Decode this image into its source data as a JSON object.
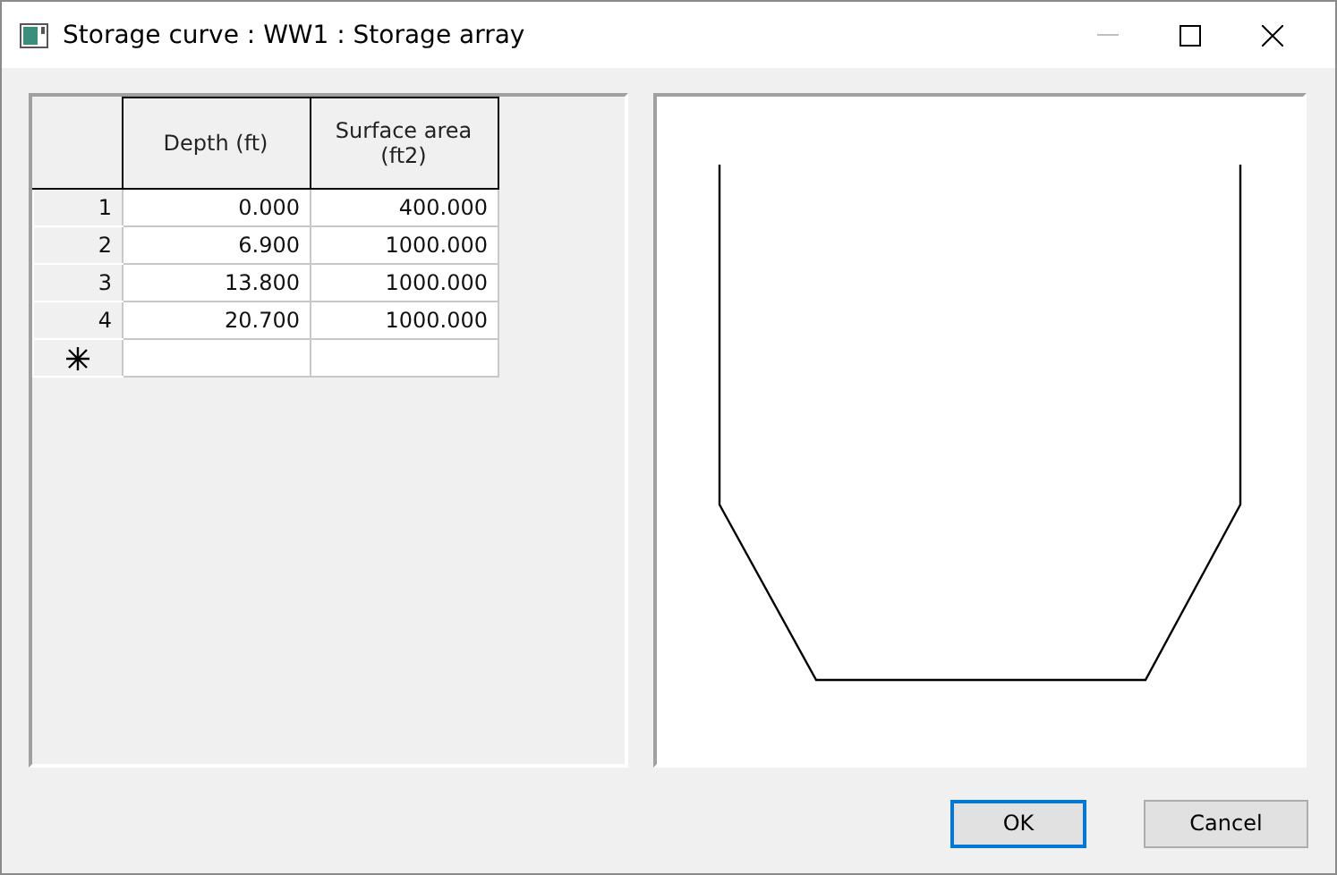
{
  "window": {
    "title": "Storage curve : WW1 : Storage array",
    "minimize_disabled": true
  },
  "table": {
    "columns": [
      "Depth (ft)",
      "Surface area (ft2)"
    ],
    "rows": [
      {
        "index": "1",
        "cells": [
          "0.000",
          "400.000"
        ]
      },
      {
        "index": "2",
        "cells": [
          "6.900",
          "1000.000"
        ]
      },
      {
        "index": "3",
        "cells": [
          "13.800",
          "1000.000"
        ]
      },
      {
        "index": "4",
        "cells": [
          "20.700",
          "1000.000"
        ]
      }
    ]
  },
  "buttons": [
    {
      "label": "OK",
      "default": true
    },
    {
      "label": "Cancel",
      "default": false
    }
  ]
}
